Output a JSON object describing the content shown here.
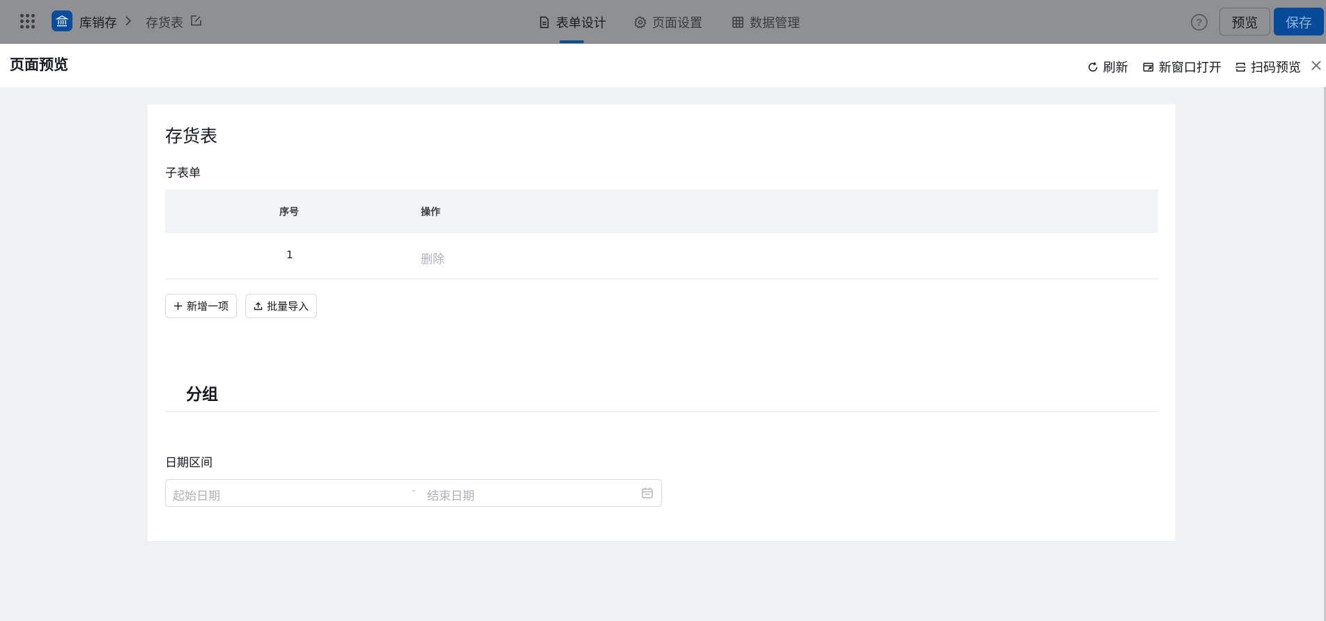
{
  "header": {
    "app_name": "库销存",
    "breadcrumb_page": "存货表",
    "tabs": [
      {
        "label": "表单设计",
        "icon": "document-icon",
        "active": true
      },
      {
        "label": "页面设置",
        "icon": "gear-icon",
        "active": false
      },
      {
        "label": "数据管理",
        "icon": "grid-icon",
        "active": false
      }
    ],
    "help": "?",
    "preview_label": "预览",
    "save_label": "保存",
    "accent_color": "#0a4d9c"
  },
  "drawer": {
    "title": "页面预览",
    "actions": {
      "refresh": "刷新",
      "new_window": "新窗口打开",
      "scan_preview": "扫码预览"
    }
  },
  "form": {
    "title": "存货表",
    "subform": {
      "label": "子表单",
      "columns": [
        "序号",
        "操作"
      ],
      "rows": [
        {
          "index": "1",
          "action": "删除"
        }
      ],
      "add_button": "新增一项",
      "import_button": "批量导入"
    },
    "group": {
      "title": "分组"
    },
    "date_range": {
      "label": "日期区间",
      "start_placeholder": "起始日期",
      "separator": "-",
      "end_placeholder": "结束日期"
    }
  }
}
